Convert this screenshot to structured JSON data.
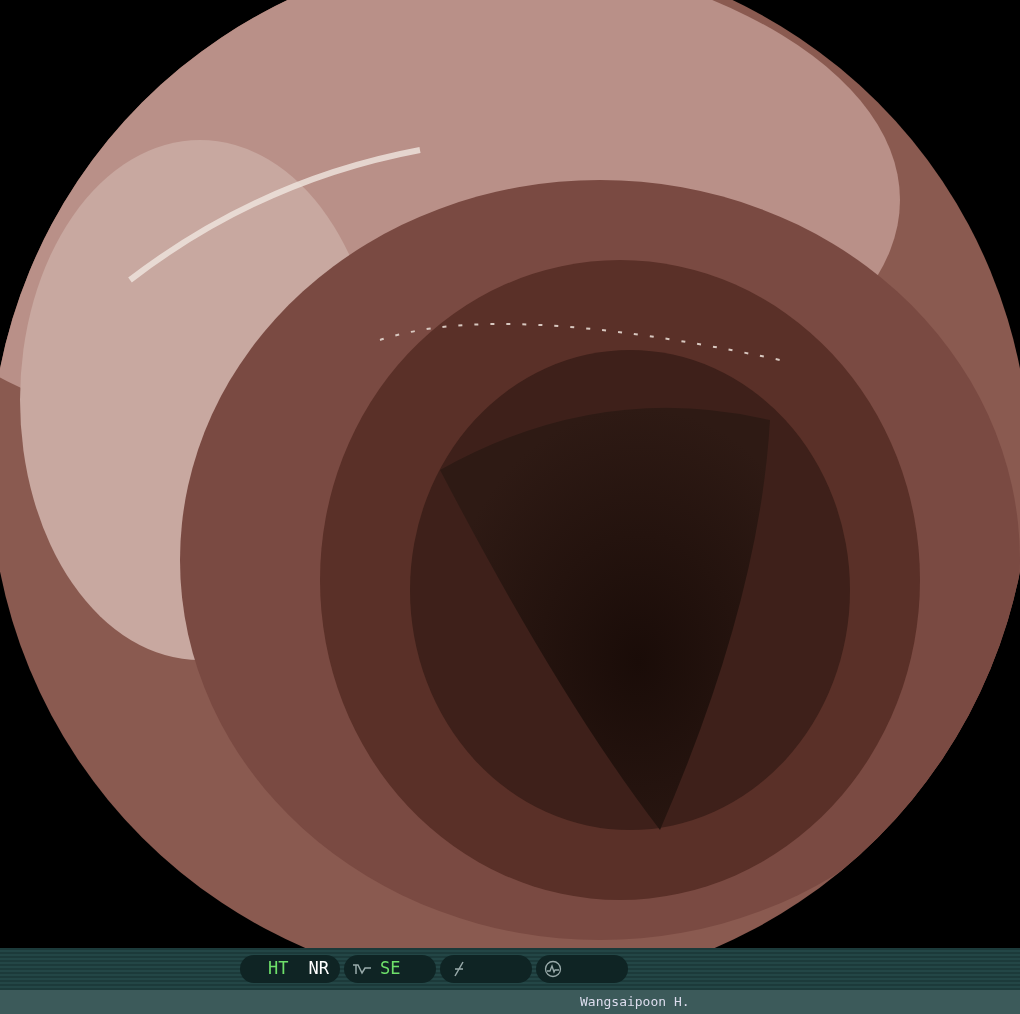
{
  "indicator_groups": [
    {
      "kind": "plain",
      "items": [
        {
          "label": "HT",
          "on": true
        },
        {
          "label": "NR",
          "on": false
        }
      ]
    },
    {
      "kind": "curve",
      "items": [
        {
          "label": "SE",
          "on": true
        }
      ]
    },
    {
      "kind": "slash"
    },
    {
      "kind": "wave"
    }
  ],
  "operator": "Wangsaipoon H."
}
